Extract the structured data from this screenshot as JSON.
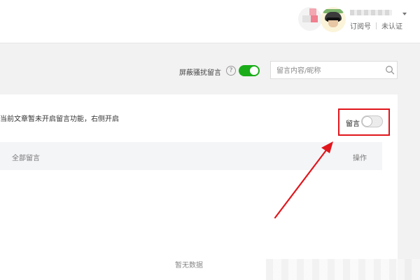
{
  "header": {
    "subscription_label": "订阅号",
    "unverified_label": "未认证"
  },
  "toolbar": {
    "block_harassment_label": "屏蔽骚扰留言",
    "search_placeholder": "留言内容/昵称"
  },
  "card": {
    "notice": "当前文章暂未开启留言功能，右侧开启",
    "message_toggle_label": "留言",
    "table_headers": {
      "all": "全部留言",
      "action": "操作"
    },
    "empty_text": "暂无数据"
  },
  "colors": {
    "accent_green": "#1aad19",
    "annotation_red": "#e0161c"
  }
}
